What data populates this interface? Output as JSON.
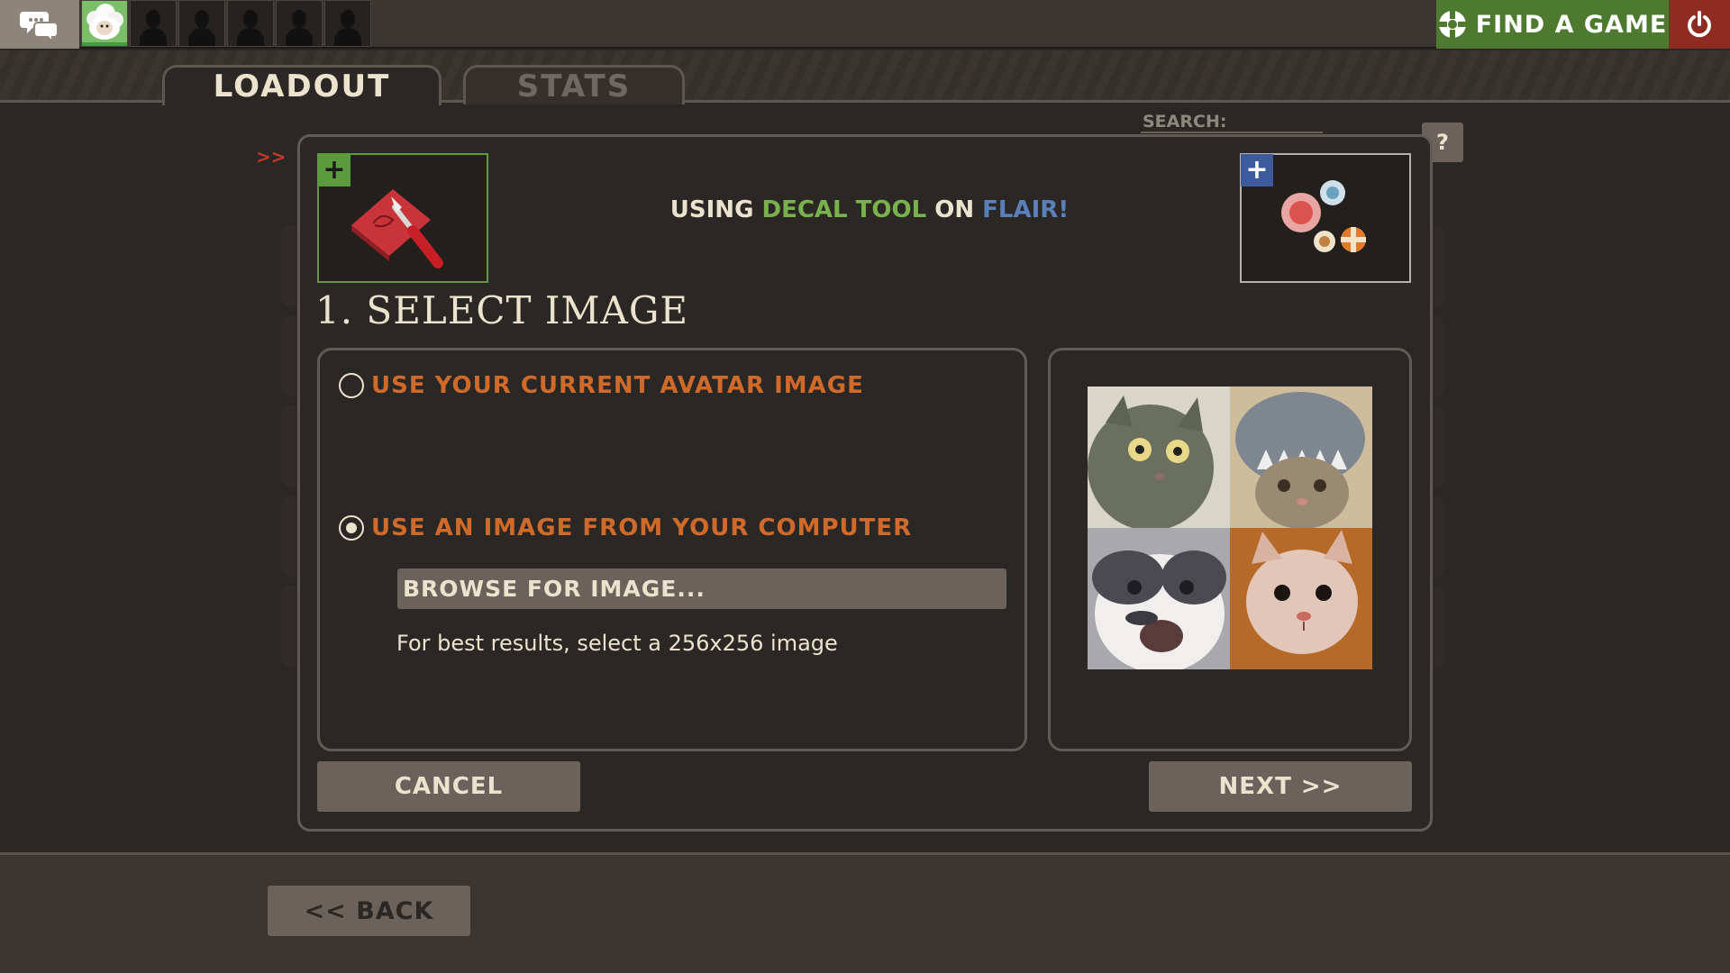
{
  "topbar": {
    "find_game_label": "FIND A GAME",
    "friend_slots": 5
  },
  "tabs": [
    {
      "label": "LOADOUT",
      "active": true
    },
    {
      "label": "STATS",
      "active": false
    }
  ],
  "search": {
    "label": "SEARCH:"
  },
  "help": {
    "label": "?"
  },
  "background": {
    "arrows": ">>"
  },
  "dialog": {
    "title_prefix": "USING",
    "tool_name": "DECAL TOOL",
    "title_mid": "ON",
    "target_name": "FLAIR!",
    "step_title": "1. SELECT IMAGE",
    "option_avatar": "USE YOUR CURRENT AVATAR IMAGE",
    "option_computer": "USE AN IMAGE FROM YOUR COMPUTER",
    "selected_option": "computer",
    "browse_label": "BROWSE FOR IMAGE...",
    "hint": "For best results, select a 256x256 image",
    "cancel_label": "CANCEL",
    "next_label": "NEXT >>"
  },
  "footer": {
    "back_label": "<< BACK"
  },
  "colors": {
    "accent_orange": "#cf6a2b",
    "tool_green": "#79b24c",
    "target_blue": "#5b7fb8",
    "find_game_green": "#4d7a2e",
    "power_red": "#8e2c21"
  }
}
